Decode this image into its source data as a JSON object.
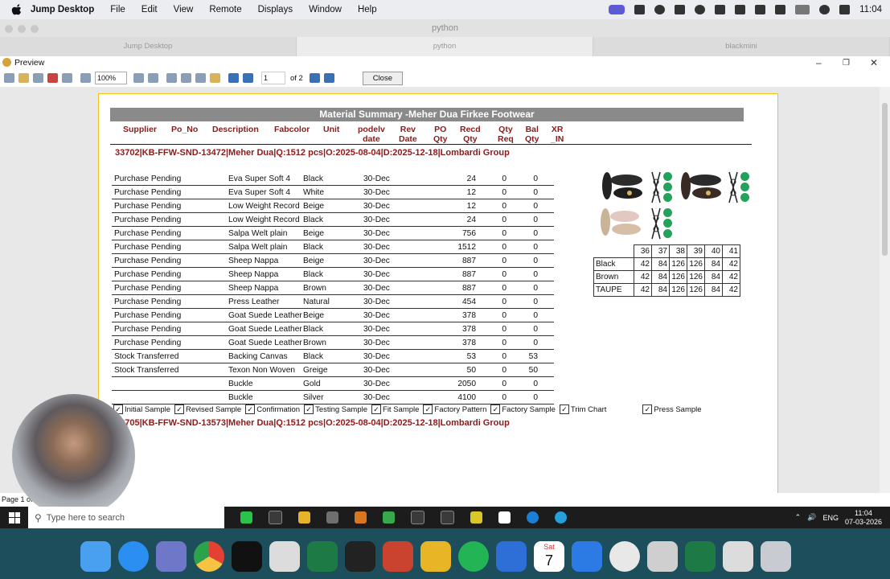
{
  "mac_menubar": {
    "app": "Jump Desktop",
    "items": [
      "File",
      "Edit",
      "View",
      "Remote",
      "Displays",
      "Window",
      "Help"
    ],
    "clock": "11:04"
  },
  "jump_window": {
    "title": "python",
    "tabs": [
      "Jump Desktop",
      "python",
      "blackmini"
    ]
  },
  "preview": {
    "title": "Preview",
    "toolbar": {
      "zoom": "100%",
      "page": "1",
      "page_of": "of 2",
      "close": "Close"
    },
    "status": "Page 1 of 2"
  },
  "report": {
    "title": "Material Summary -Meher  Dua Firkee Footwear",
    "headers": [
      {
        "l1": "Supplier",
        "l2": ""
      },
      {
        "l1": "Po_No",
        "l2": ""
      },
      {
        "l1": "Description",
        "l2": ""
      },
      {
        "l1": "Fabcolor",
        "l2": ""
      },
      {
        "l1": "Unit",
        "l2": ""
      },
      {
        "l1": "podelv",
        "l2": "date"
      },
      {
        "l1": "Rev",
        "l2": "Date"
      },
      {
        "l1": "PO",
        "l2": "Qty"
      },
      {
        "l1": "Recd",
        "l2": "Qty"
      },
      {
        "l1": "Qty",
        "l2": "Req"
      },
      {
        "l1": "Bal",
        "l2": "Qty"
      },
      {
        "l1": "XR",
        "l2": "_IN"
      }
    ],
    "order1": "33702|KB-FFW-SND-13472|Meher  Dua|Q:1512 pcs|O:2025-08-04|D:2025-12-18|Lombardi Group",
    "rows": [
      {
        "status": "Purchase Pending",
        "desc": "Eva Super Soft 4",
        "color": "Black",
        "date": "30-Dec",
        "qty": "24",
        "bal": "0",
        "xr": "0"
      },
      {
        "status": "Purchase Pending",
        "desc": "Eva Super Soft 4",
        "color": "White",
        "date": "30-Dec",
        "qty": "12",
        "bal": "0",
        "xr": "0"
      },
      {
        "status": "Purchase Pending",
        "desc": "Low Weight Record",
        "color": "Beige",
        "date": "30-Dec",
        "qty": "12",
        "bal": "0",
        "xr": "0"
      },
      {
        "status": "Purchase Pending",
        "desc": "Low Weight Record",
        "color": "Black",
        "date": "30-Dec",
        "qty": "24",
        "bal": "0",
        "xr": "0"
      },
      {
        "status": "Purchase Pending",
        "desc": "Salpa Welt plain",
        "color": "Beige",
        "date": "30-Dec",
        "qty": "756",
        "bal": "0",
        "xr": "0"
      },
      {
        "status": "Purchase Pending",
        "desc": "Salpa Welt plain",
        "color": "Black",
        "date": "30-Dec",
        "qty": "1512",
        "bal": "0",
        "xr": "0"
      },
      {
        "status": "Purchase Pending",
        "desc": "Sheep Nappa",
        "color": "Beige",
        "date": "30-Dec",
        "qty": "887",
        "bal": "0",
        "xr": "0"
      },
      {
        "status": "Purchase Pending",
        "desc": "Sheep Nappa",
        "color": "Black",
        "date": "30-Dec",
        "qty": "887",
        "bal": "0",
        "xr": "0"
      },
      {
        "status": "Purchase Pending",
        "desc": "Sheep Nappa",
        "color": "Brown",
        "date": "30-Dec",
        "qty": "887",
        "bal": "0",
        "xr": "0"
      },
      {
        "status": "Purchase Pending",
        "desc": "Press Leather",
        "color": "Natural",
        "date": "30-Dec",
        "qty": "454",
        "bal": "0",
        "xr": "0"
      },
      {
        "status": "Purchase Pending",
        "desc": "Goat Suede Leather",
        "color": "Beige",
        "date": "30-Dec",
        "qty": "378",
        "bal": "0",
        "xr": "0"
      },
      {
        "status": "Purchase Pending",
        "desc": "Goat Suede Leather",
        "color": "Black",
        "date": "30-Dec",
        "qty": "378",
        "bal": "0",
        "xr": "0"
      },
      {
        "status": "Purchase Pending",
        "desc": "Goat Suede Leather",
        "color": "Brown",
        "date": "30-Dec",
        "qty": "378",
        "bal": "0",
        "xr": "0"
      },
      {
        "status": "Stock Transferred",
        "desc": "Backing Canvas",
        "color": "Black",
        "date": "30-Dec",
        "qty": "53",
        "bal": "0",
        "xr": "53"
      },
      {
        "status": "Stock Transferred",
        "desc": "Texon Non Woven",
        "color": "Greige",
        "date": "30-Dec",
        "qty": "50",
        "bal": "0",
        "xr": "50"
      },
      {
        "status": "",
        "desc": "Buckle",
        "color": "Gold",
        "date": "30-Dec",
        "qty": "2050",
        "bal": "0",
        "xr": "0"
      },
      {
        "status": "",
        "desc": "Buckle",
        "color": "Silver",
        "date": "30-Dec",
        "qty": "4100",
        "bal": "0",
        "xr": "0"
      }
    ],
    "checks": [
      "Initial Sample",
      "Revised Sample",
      "Confirmation",
      "Testing Sample",
      "Fit Sample",
      "Factory Pattern",
      "Factory Sample",
      "Trim Chart",
      "Press Sample"
    ],
    "order2": "33705|KB-FFW-SND-13573|Meher  Dua|Q:1512 pcs|O:2025-08-04|D:2025-12-18|Lombardi Group",
    "sizes": [
      "36",
      "37",
      "38",
      "39",
      "40",
      "41"
    ],
    "size_rows": [
      {
        "color": "Black",
        "vals": [
          "42",
          "84",
          "126",
          "126",
          "84",
          "42"
        ]
      },
      {
        "color": "Brown",
        "vals": [
          "42",
          "84",
          "126",
          "126",
          "84",
          "42"
        ]
      },
      {
        "color": "TAUPE",
        "vals": [
          "42",
          "84",
          "126",
          "126",
          "84",
          "42"
        ]
      }
    ]
  },
  "taskbar": {
    "search_placeholder": "Type here to search",
    "lang": "ENG",
    "time": "11:04",
    "date": "07-03-2026"
  },
  "dock": {
    "calendar_month": "Sat",
    "calendar_day": "7"
  }
}
